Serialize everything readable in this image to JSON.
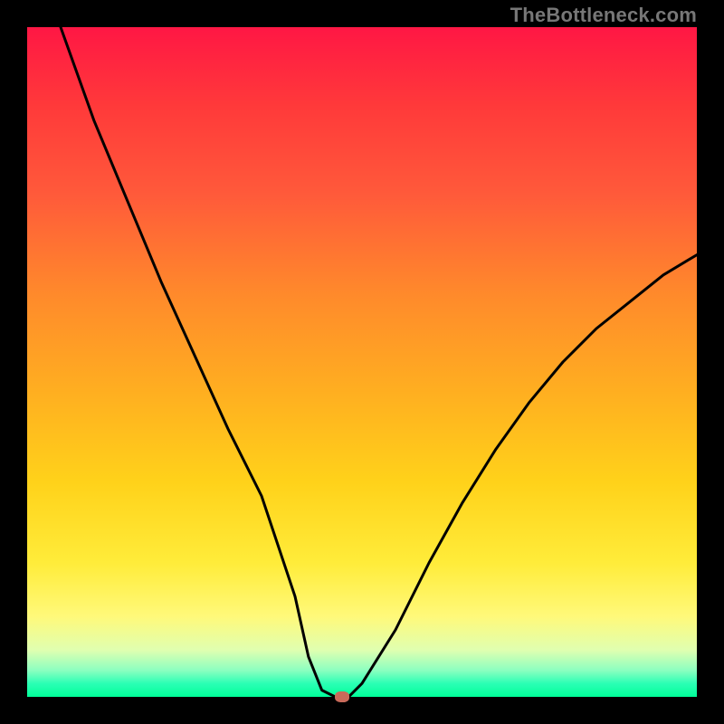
{
  "watermark": "TheBottleneck.com",
  "colors": {
    "frame": "#000000",
    "curve": "#000000",
    "marker": "#c96a5a",
    "gradient_top": "#ff1744",
    "gradient_bottom": "#00ff99"
  },
  "chart_data": {
    "type": "line",
    "title": "",
    "xlabel": "",
    "ylabel": "",
    "xlim": [
      0,
      100
    ],
    "ylim": [
      0,
      100
    ],
    "grid": false,
    "legend": false,
    "series": [
      {
        "name": "bottleneck-curve",
        "x": [
          5,
          10,
          15,
          20,
          25,
          30,
          35,
          40,
          42,
          44,
          46,
          48,
          50,
          55,
          60,
          65,
          70,
          75,
          80,
          85,
          90,
          95,
          100
        ],
        "y": [
          100,
          86,
          74,
          62,
          51,
          40,
          30,
          15,
          6,
          1,
          0,
          0,
          2,
          10,
          20,
          29,
          37,
          44,
          50,
          55,
          59,
          63,
          66
        ]
      }
    ],
    "marker": {
      "x": 47,
      "y": 0
    },
    "annotations": []
  }
}
